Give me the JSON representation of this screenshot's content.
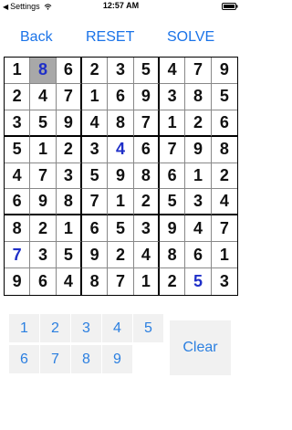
{
  "status_bar": {
    "carrier": "Settings",
    "back_glyph": "◀",
    "time": "12:57 AM",
    "wifi_icon": "wifi-icon",
    "battery_icon": "battery-icon"
  },
  "nav": {
    "back": "Back",
    "reset": "RESET",
    "solve": "SOLVE"
  },
  "board": {
    "rows": [
      [
        "1",
        "8",
        "6",
        "2",
        "3",
        "5",
        "4",
        "7",
        "9"
      ],
      [
        "2",
        "4",
        "7",
        "1",
        "6",
        "9",
        "3",
        "8",
        "5"
      ],
      [
        "3",
        "5",
        "9",
        "4",
        "8",
        "7",
        "1",
        "2",
        "6"
      ],
      [
        "5",
        "1",
        "2",
        "3",
        "4",
        "6",
        "7",
        "9",
        "8"
      ],
      [
        "4",
        "7",
        "3",
        "5",
        "9",
        "8",
        "6",
        "1",
        "2"
      ],
      [
        "6",
        "9",
        "8",
        "7",
        "1",
        "2",
        "5",
        "3",
        "4"
      ],
      [
        "8",
        "2",
        "1",
        "6",
        "5",
        "3",
        "9",
        "4",
        "7"
      ],
      [
        "7",
        "3",
        "5",
        "9",
        "2",
        "4",
        "8",
        "6",
        "1"
      ],
      [
        "9",
        "6",
        "4",
        "8",
        "7",
        "1",
        "2",
        "5",
        "3"
      ]
    ],
    "user_entries": [
      [
        0,
        1
      ],
      [
        3,
        4
      ],
      [
        7,
        0
      ],
      [
        8,
        7
      ]
    ],
    "selected": [
      0,
      1
    ],
    "colors": {
      "given": "#111111",
      "user": "#1f2fc8",
      "selected_bg": "#a8a8a8"
    }
  },
  "keypad": {
    "keys": [
      "1",
      "2",
      "3",
      "4",
      "5",
      "6",
      "7",
      "8",
      "9"
    ],
    "clear": "Clear",
    "accent": "#2b7fe0"
  }
}
